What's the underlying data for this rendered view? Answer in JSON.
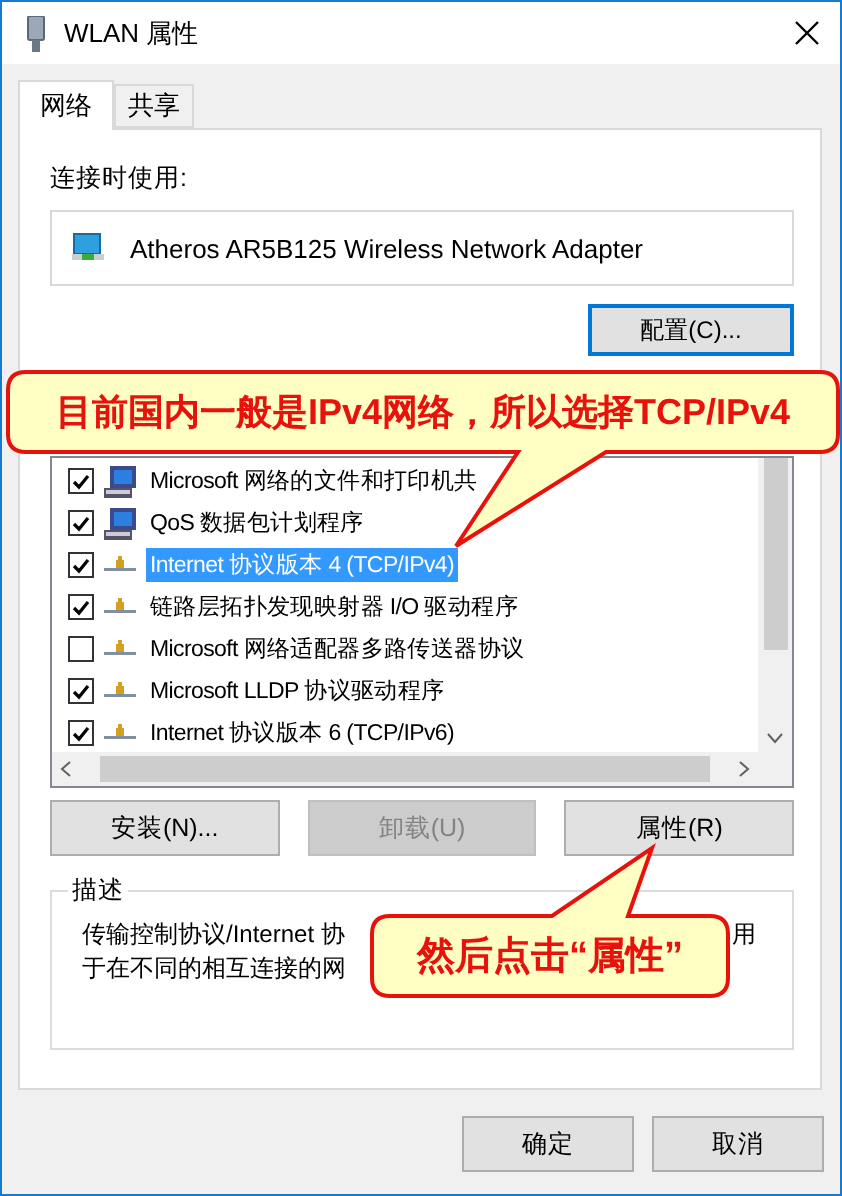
{
  "window": {
    "title": "WLAN 属性"
  },
  "tabs": [
    {
      "label": "网络",
      "selected": true
    },
    {
      "label": "共享",
      "selected": false
    }
  ],
  "connect_using": {
    "label": "连接时使用:",
    "adapter": "Atheros AR5B125 Wireless Network Adapter",
    "configure_button": "配置(C)..."
  },
  "items": [
    {
      "label": "Microsoft 网络的文件和打印机共",
      "kind": "client",
      "checked": true,
      "selected": false
    },
    {
      "label": "QoS 数据包计划程序",
      "kind": "client",
      "checked": true,
      "selected": false
    },
    {
      "label": "Internet 协议版本 4 (TCP/IPv4)",
      "kind": "protocol",
      "checked": true,
      "selected": true
    },
    {
      "label": "链路层拓扑发现映射器 I/O 驱动程序",
      "kind": "protocol",
      "checked": true,
      "selected": false
    },
    {
      "label": "Microsoft 网络适配器多路传送器协议",
      "kind": "protocol",
      "checked": false,
      "selected": false
    },
    {
      "label": "Microsoft LLDP 协议驱动程序",
      "kind": "protocol",
      "checked": true,
      "selected": false
    },
    {
      "label": "Internet 协议版本 6 (TCP/IPv6)",
      "kind": "protocol",
      "checked": true,
      "selected": false
    }
  ],
  "item_buttons": [
    {
      "label": "安装(N)...",
      "disabled": false
    },
    {
      "label": "卸载(U)",
      "disabled": true
    },
    {
      "label": "属性(R)",
      "disabled": false
    }
  ],
  "description": {
    "title": "描述",
    "line_1_start": "传输控制协议/Internet 协",
    "line_1_end": "用",
    "line_2": "于在不同的相互连接的网"
  },
  "dialog_buttons": [
    "确定",
    "取消"
  ],
  "callouts": [
    {
      "text": "目前国内一般是IPv4网络，所以选择TCP/IPv4"
    },
    {
      "text": "然后点击“属性”"
    }
  ]
}
